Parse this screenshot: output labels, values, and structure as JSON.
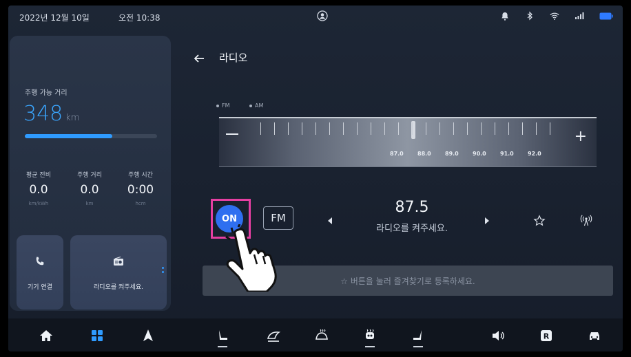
{
  "status_bar": {
    "date": "2022년 12월 10일",
    "time": "오전 10:38",
    "icons": [
      "profile-icon",
      "bell-icon",
      "bluetooth-icon",
      "wifi-icon",
      "signal-icon",
      "battery-icon"
    ]
  },
  "left_panel": {
    "range_label": "주행 가능 거리",
    "range_value": "348",
    "range_unit": "km",
    "range_fill_fraction": 0.66,
    "stats": [
      {
        "label": "평균 전비",
        "value": "0.0",
        "unit": "km/kWh"
      },
      {
        "label": "주행 거리",
        "value": "0.0",
        "unit": "km"
      },
      {
        "label": "주행 시간",
        "value": "0:00",
        "unit": "hcm"
      }
    ],
    "tiles": {
      "phone_label": "기기 연결",
      "radio_label": "라디오를 켜주세요."
    }
  },
  "header": {
    "title": "라디오"
  },
  "radio": {
    "bands": [
      "FM",
      "AM"
    ],
    "dial_frequencies": [
      "87.0",
      "88.0",
      "89.0",
      "90.0",
      "91.0",
      "92.0"
    ],
    "on_label": "ON",
    "band_label": "FM",
    "frequency": "87.5",
    "status_message": "라디오를 켜주세요.",
    "favorites_hint": "☆ 버튼을 눌러 즐겨찾기로 등록하세요."
  },
  "colors": {
    "accent": "#2f9bff",
    "on_button": "#2f6ff0",
    "highlight": "#e63fa2",
    "background": "#1a2230"
  },
  "bottom_bar": {
    "icons": [
      "home-icon",
      "apps-icon",
      "navigation-icon",
      "seat-driver-icon",
      "fan-icon",
      "defrost-icon",
      "seat-heat-icon",
      "seat-passenger-icon",
      "volume-icon",
      "rear-icon",
      "car-icon"
    ]
  }
}
